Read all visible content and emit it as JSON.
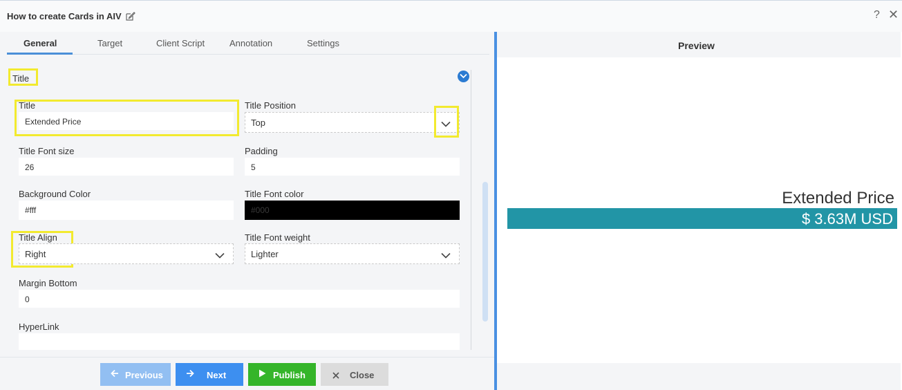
{
  "dialog": {
    "title": "How to create Cards in AIV",
    "help": "?",
    "close": "✕"
  },
  "tabs": [
    {
      "label": "General",
      "active": true
    },
    {
      "label": "Target"
    },
    {
      "label": "Client Script"
    },
    {
      "label": "Annotation"
    },
    {
      "label": "Settings"
    }
  ],
  "section": {
    "title": "Title"
  },
  "fields": {
    "title": {
      "label": "Title",
      "value": "Extended Price"
    },
    "title_position": {
      "label": "Title Position",
      "value": "Top"
    },
    "title_font_size": {
      "label": "Title Font size",
      "value": "26"
    },
    "padding": {
      "label": "Padding",
      "value": "5"
    },
    "background_color": {
      "label": "Background Color",
      "value": "#fff"
    },
    "title_font_color": {
      "label": "Title Font color",
      "value": "#000",
      "swatch": "#000000"
    },
    "title_align": {
      "label": "Title Align",
      "value": "Right"
    },
    "title_font_weight": {
      "label": "Title Font weight",
      "value": "Lighter"
    },
    "margin_bottom": {
      "label": "Margin Bottom",
      "value": "0"
    },
    "hyperlink": {
      "label": "HyperLink",
      "value": ""
    }
  },
  "footer": {
    "previous": "Previous",
    "next": "Next",
    "publish": "Publish",
    "close": "Close"
  },
  "preview": {
    "header": "Preview",
    "card_title": "Extended Price",
    "card_value": "$ 3.63M USD",
    "card_value_bg": "#2295a6"
  },
  "colors": {
    "accent": "#4a90e2",
    "highlight": "#f2ea2f",
    "publish": "#35b52a",
    "next": "#3d8ff0",
    "previous": "#92bff2",
    "close_btn": "#dcdcdc"
  }
}
